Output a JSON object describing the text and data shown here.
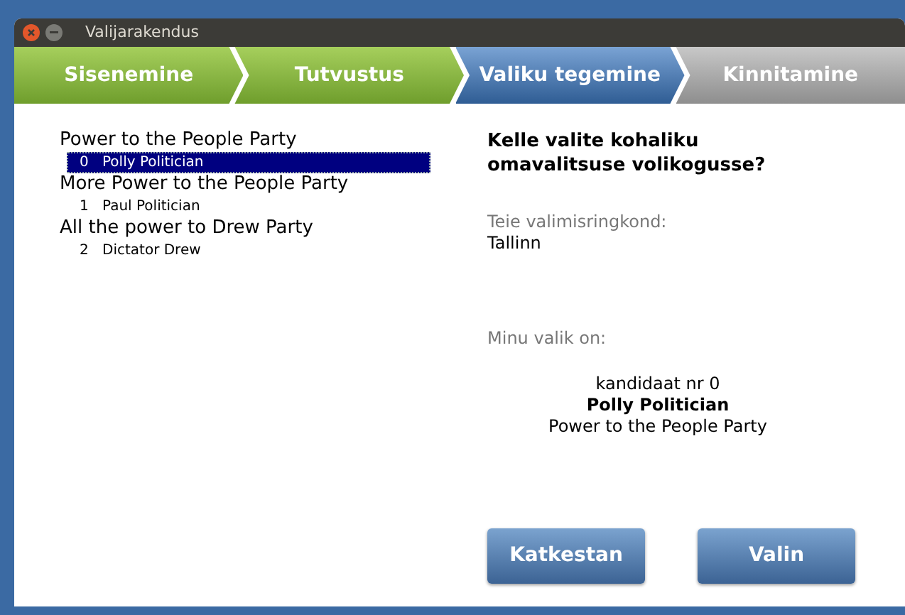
{
  "window": {
    "title": "Valijarakendus"
  },
  "steps": [
    {
      "label": "Sisenemine",
      "kind": "done"
    },
    {
      "label": "Tutvustus",
      "kind": "done"
    },
    {
      "label": "Valiku tegemine",
      "kind": "current"
    },
    {
      "label": "Kinnitamine",
      "kind": "pending"
    }
  ],
  "tree": [
    {
      "label": "Power to the People Party",
      "children": [
        {
          "number": "0",
          "name": "Polly Politician",
          "selected": true
        }
      ]
    },
    {
      "label": "More Power to the People Party",
      "children": [
        {
          "number": "1",
          "name": "Paul Politician",
          "selected": false
        }
      ]
    },
    {
      "label": "All the power to Drew Party",
      "children": [
        {
          "number": "2",
          "name": "Dictator Drew",
          "selected": false
        }
      ]
    }
  ],
  "question": "Kelle valite kohaliku omavalitsuse volikogusse?",
  "district": {
    "label": "Teie valimisringkond:",
    "value": "Tallinn"
  },
  "choice": {
    "label": "Minu valik on:",
    "number": "kandidaat nr 0",
    "name": "Polly Politician",
    "party": "Power to the People Party"
  },
  "buttons": [
    "Katkestan",
    "Valin"
  ]
}
